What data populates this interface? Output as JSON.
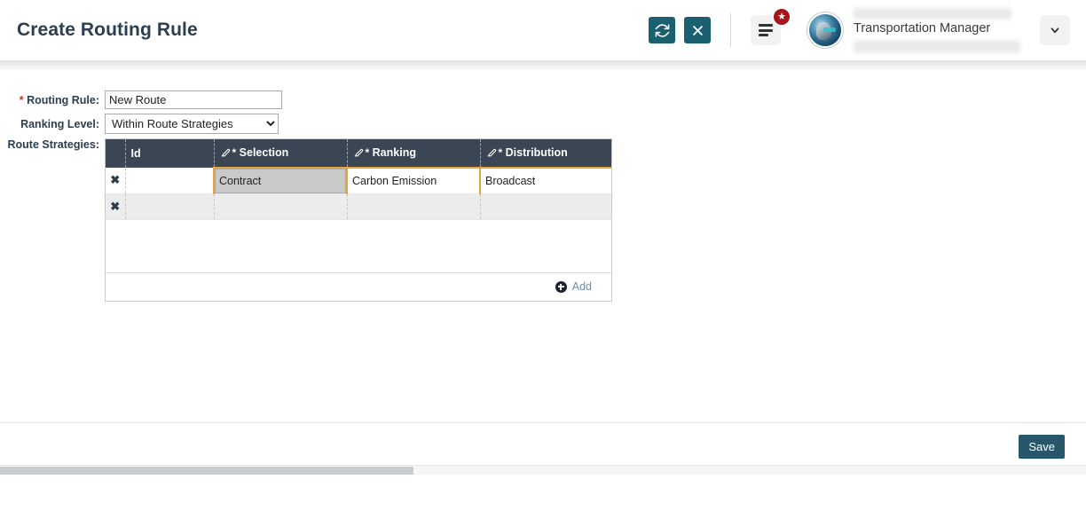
{
  "header": {
    "title": "Create Routing Rule",
    "refresh_icon": "refresh-sync-icon",
    "close_icon": "close-x-icon",
    "menu_icon": "hamburger-menu-icon",
    "badge_icon": "star-icon",
    "avatar_icon": "user-avatar",
    "user_role": "Transportation Manager",
    "caret_icon": "chevron-down-icon"
  },
  "form": {
    "routing_rule": {
      "label": "Routing Rule:",
      "required_mark": "*",
      "value": "New Route",
      "placeholder": ""
    },
    "ranking_level": {
      "label": "Ranking Level:",
      "value": "Within Route Strategies",
      "options": [
        "Within Route Strategies"
      ]
    },
    "route_strategies": {
      "label": "Route Strategies:"
    }
  },
  "grid": {
    "columns": [
      {
        "key": "x",
        "label": "",
        "edit_icon": false,
        "required": false
      },
      {
        "key": "id",
        "label": "Id",
        "edit_icon": false,
        "required": false
      },
      {
        "key": "selection",
        "label": "Selection",
        "edit_icon": true,
        "required": true
      },
      {
        "key": "ranking",
        "label": "Ranking",
        "edit_icon": true,
        "required": true
      },
      {
        "key": "distribution",
        "label": "Distribution",
        "edit_icon": true,
        "required": true
      }
    ],
    "required_mark": "*",
    "delete_icon": "delete-x-icon",
    "rows": [
      {
        "id": "",
        "selection": "Contract",
        "ranking": "Carbon Emission",
        "distribution": "Broadcast"
      },
      {
        "id": "",
        "selection": "",
        "ranking": "",
        "distribution": ""
      }
    ],
    "add": {
      "label": "Add",
      "icon": "plus-circle-icon"
    }
  },
  "footer": {
    "save_label": "Save"
  }
}
